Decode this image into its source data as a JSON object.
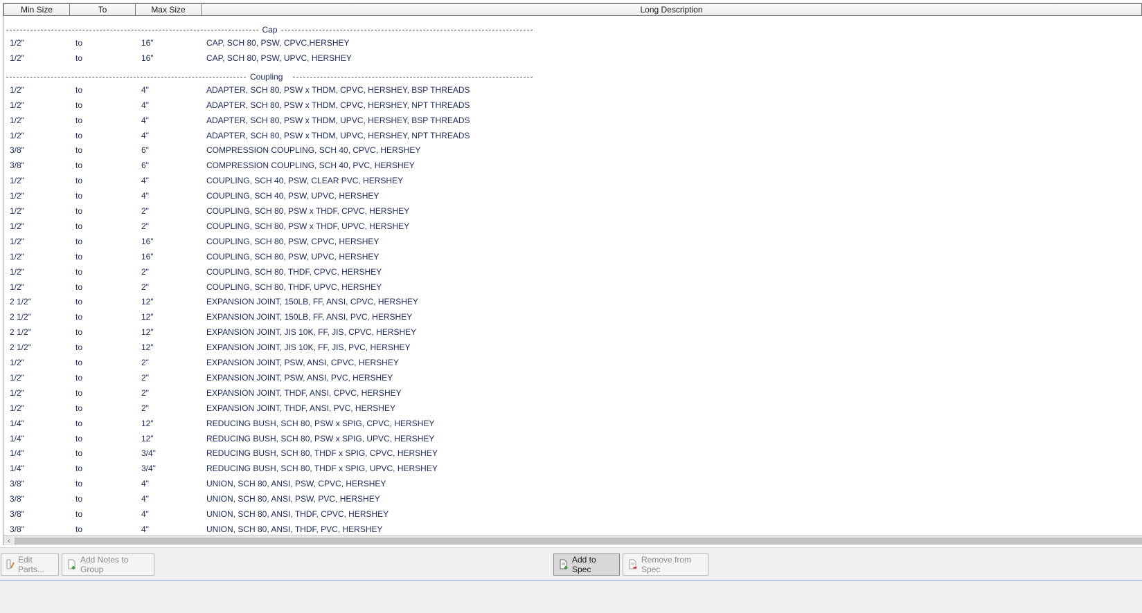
{
  "columns": [
    "Min Size",
    "To",
    "Max Size",
    "Long Description"
  ],
  "groups": [
    {
      "title": "Cap",
      "rows": [
        [
          "1/2\"",
          "to",
          "16\"",
          "CAP, SCH 80, PSW, CPVC,HERSHEY"
        ],
        [
          "1/2\"",
          "to",
          "16\"",
          "CAP, SCH 80, PSW, UPVC, HERSHEY"
        ]
      ]
    },
    {
      "title": "Coupling",
      "rows": [
        [
          "1/2\"",
          "to",
          "4\"",
          "ADAPTER, SCH 80, PSW x THDM, CPVC, HERSHEY, BSP THREADS"
        ],
        [
          "1/2\"",
          "to",
          "4\"",
          "ADAPTER, SCH 80, PSW x THDM, CPVC, HERSHEY, NPT THREADS"
        ],
        [
          "1/2\"",
          "to",
          "4\"",
          "ADAPTER, SCH 80, PSW x THDM, UPVC, HERSHEY, BSP THREADS"
        ],
        [
          "1/2\"",
          "to",
          "4\"",
          "ADAPTER, SCH 80, PSW x THDM, UPVC, HERSHEY, NPT THREADS"
        ],
        [
          "3/8\"",
          "to",
          "6\"",
          "COMPRESSION COUPLING, SCH 40, CPVC, HERSHEY"
        ],
        [
          "3/8\"",
          "to",
          "6\"",
          "COMPRESSION COUPLING, SCH 40, PVC, HERSHEY"
        ],
        [
          "1/2\"",
          "to",
          "4\"",
          "COUPLING, SCH 40, PSW, CLEAR PVC, HERSHEY"
        ],
        [
          "1/2\"",
          "to",
          "4\"",
          "COUPLING, SCH 40, PSW, UPVC, HERSHEY"
        ],
        [
          "1/2\"",
          "to",
          "2\"",
          "COUPLING, SCH 80, PSW x THDF, CPVC, HERSHEY"
        ],
        [
          "1/2\"",
          "to",
          "2\"",
          "COUPLING, SCH 80, PSW x THDF, UPVC, HERSHEY"
        ],
        [
          "1/2\"",
          "to",
          "16\"",
          "COUPLING, SCH 80, PSW, CPVC, HERSHEY"
        ],
        [
          "1/2\"",
          "to",
          "16\"",
          "COUPLING, SCH 80, PSW, UPVC, HERSHEY"
        ],
        [
          "1/2\"",
          "to",
          "2\"",
          "COUPLING, SCH 80, THDF, CPVC, HERSHEY"
        ],
        [
          "1/2\"",
          "to",
          "2\"",
          "COUPLING, SCH 80, THDF, UPVC, HERSHEY"
        ],
        [
          "2 1/2\"",
          "to",
          "12\"",
          "EXPANSION JOINT, 150LB, FF, ANSI, CPVC, HERSHEY"
        ],
        [
          "2 1/2\"",
          "to",
          "12\"",
          "EXPANSION JOINT, 150LB, FF, ANSI, PVC, HERSHEY"
        ],
        [
          "2 1/2\"",
          "to",
          "12\"",
          "EXPANSION JOINT, JIS 10K, FF, JIS, CPVC, HERSHEY"
        ],
        [
          "2 1/2\"",
          "to",
          "12\"",
          "EXPANSION JOINT, JIS 10K, FF, JIS, PVC, HERSHEY"
        ],
        [
          "1/2\"",
          "to",
          "2\"",
          "EXPANSION JOINT, PSW, ANSI, CPVC, HERSHEY"
        ],
        [
          "1/2\"",
          "to",
          "2\"",
          "EXPANSION JOINT, PSW, ANSI, PVC, HERSHEY"
        ],
        [
          "1/2\"",
          "to",
          "2\"",
          "EXPANSION JOINT, THDF, ANSI, CPVC, HERSHEY"
        ],
        [
          "1/2\"",
          "to",
          "2\"",
          "EXPANSION JOINT, THDF, ANSI, PVC, HERSHEY"
        ],
        [
          "1/4\"",
          "to",
          "12\"",
          "REDUCING BUSH, SCH 80, PSW x SPIG, CPVC, HERSHEY"
        ],
        [
          "1/4\"",
          "to",
          "12\"",
          "REDUCING BUSH, SCH 80, PSW x SPIG, UPVC, HERSHEY"
        ],
        [
          "1/4\"",
          "to",
          "3/4\"",
          "REDUCING BUSH, SCH 80, THDF x SPIG, CPVC, HERSHEY"
        ],
        [
          "1/4\"",
          "to",
          "3/4\"",
          "REDUCING BUSH, SCH 80, THDF x SPIG, UPVC, HERSHEY"
        ],
        [
          "3/8\"",
          "to",
          "4\"",
          "UNION, SCH 80, ANSI, PSW, CPVC, HERSHEY"
        ],
        [
          "3/8\"",
          "to",
          "4\"",
          "UNION, SCH 80, ANSI, PSW, PVC, HERSHEY"
        ],
        [
          "3/8\"",
          "to",
          "4\"",
          "UNION, SCH 80, ANSI, THDF, CPVC, HERSHEY"
        ],
        [
          "3/8\"",
          "to",
          "4\"",
          "UNION, SCH 80, ANSI, THDF, PVC, HERSHEY"
        ]
      ]
    }
  ],
  "toolbar": {
    "edit_parts": "Edit Parts...",
    "add_notes": "Add Notes to Group",
    "add_to_spec": "Add to Spec",
    "remove_from_spec": "Remove from Spec"
  },
  "icons": {
    "edit_parts": "edit-parts-icon",
    "add_notes": "add-notes-icon",
    "add_to_spec": "add-to-spec-icon",
    "remove_from_spec": "remove-from-spec-icon",
    "scroll_left": "scroll-left-arrow-icon"
  },
  "colors": {
    "text": "#1a2a5a",
    "add_green": "#3a9a3a",
    "remove_red": "#cc2a2a"
  }
}
